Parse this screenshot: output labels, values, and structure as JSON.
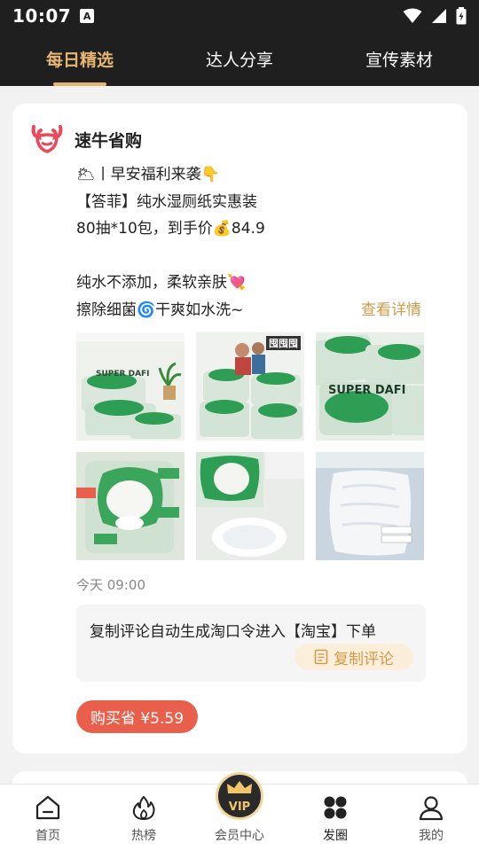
{
  "status_bar": {
    "time": "10:07",
    "a_icon": "A"
  },
  "tabs": [
    {
      "label": "每日精选",
      "active": true
    },
    {
      "label": "达人分享",
      "active": false
    },
    {
      "label": "宣传素材",
      "active": false
    }
  ],
  "post": {
    "shop_name": "速牛省购",
    "lines": [
      "🌥丨早安福利来袭👇",
      "【答菲】纯水湿厕纸实惠装",
      "80抽*10包，到手价💰84.9",
      "",
      "纯水不添加，柔软亲肤💘",
      "擦除细菌🌀干爽如水洗~"
    ],
    "detail_link": "查看详情",
    "image_captions": [
      "SUPER DAFI",
      "囤囤囤",
      "SUPER DAFI",
      "",
      "",
      ""
    ],
    "time": "今天 09:00",
    "copy_hint": "复制评论自动生成淘口令进入【淘宝】下单",
    "copy_button": "复制评论",
    "buy_button": "购买省 ¥5.59"
  },
  "bottom_nav": [
    {
      "label": "首页",
      "icon": "home-icon"
    },
    {
      "label": "热榜",
      "icon": "flame-icon"
    },
    {
      "label": "会员中心",
      "icon": "vip-crown-icon"
    },
    {
      "label": "发圈",
      "icon": "circles-icon"
    },
    {
      "label": "我的",
      "icon": "person-icon"
    }
  ],
  "vip_text": "VIP",
  "colors": {
    "accent": "#e8b571",
    "link": "#d49a49",
    "buy": "#e8604c",
    "header_bg": "#1f1f1f"
  }
}
